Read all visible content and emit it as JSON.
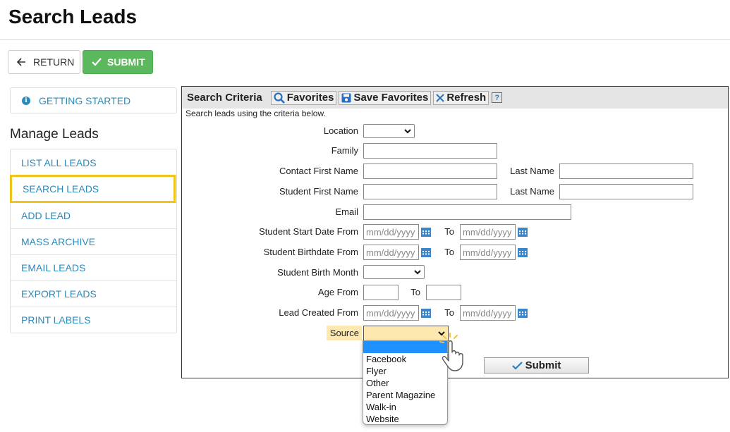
{
  "page": {
    "title": "Search Leads"
  },
  "toolbar": {
    "return_label": "RETURN",
    "submit_label": "SUBMIT"
  },
  "sidebar": {
    "getting_started": "GETTING STARTED",
    "section_title": "Manage Leads",
    "items": [
      {
        "label": "LIST ALL LEADS",
        "active": false
      },
      {
        "label": "SEARCH LEADS",
        "active": true
      },
      {
        "label": "ADD LEAD",
        "active": false
      },
      {
        "label": "MASS ARCHIVE",
        "active": false
      },
      {
        "label": "EMAIL LEADS",
        "active": false
      },
      {
        "label": "EXPORT LEADS",
        "active": false
      },
      {
        "label": "PRINT LABELS",
        "active": false
      }
    ]
  },
  "criteria": {
    "title": "Search Criteria",
    "favorites_label": "Favorites",
    "save_favorites_label": "Save Favorites",
    "refresh_label": "Refresh",
    "help_label": "?",
    "description": "Search leads using the criteria below.",
    "labels": {
      "location": "Location",
      "family": "Family",
      "contact_first_name": "Contact First Name",
      "last_name": "Last Name",
      "student_first_name": "Student First Name",
      "email": "Email",
      "student_start_date_from": "Student Start Date From",
      "student_birthdate_from": "Student Birthdate From",
      "student_birth_month": "Student Birth Month",
      "age_from": "Age From",
      "lead_created_from": "Lead Created From",
      "to": "To",
      "source": "Source"
    },
    "date_placeholder": "mm/dd/yyyy",
    "submit_label": "Submit",
    "source_options": [
      "",
      "Facebook",
      "Flyer",
      "Other",
      "Parent Magazine",
      "Walk-in",
      "Website"
    ]
  },
  "colors": {
    "accent_green": "#5cb85c",
    "link_blue": "#2a8bbf",
    "active_border": "#f0c419",
    "source_highlight": "#fde9b0",
    "option_highlight": "#1e90ff"
  }
}
